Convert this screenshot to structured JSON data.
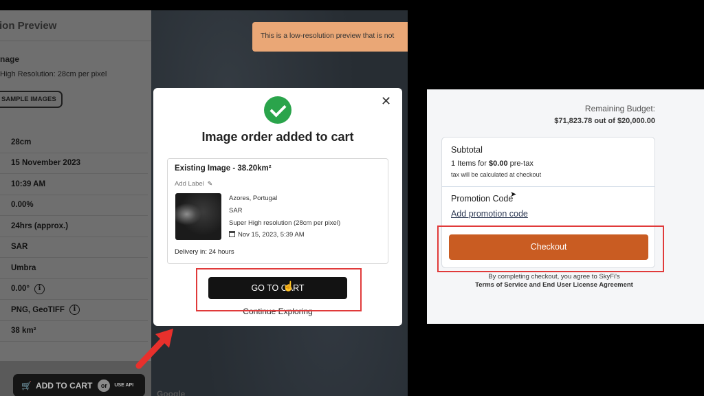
{
  "left_app": {
    "sidebar": {
      "header_title": "tion Preview",
      "section_title": "nage",
      "resolution_text": "High Resolution: 28cm per pixel",
      "sample_button": "SAMPLE IMAGES",
      "rows": [
        {
          "value": "28cm"
        },
        {
          "value": "15 November 2023"
        },
        {
          "value": "10:39 AM"
        },
        {
          "value": "0.00%"
        },
        {
          "value": "24hrs (approx.)"
        },
        {
          "value": "SAR"
        },
        {
          "value": "Umbra"
        },
        {
          "value": "0.00°",
          "info": true
        },
        {
          "value": "PNG, GeoTIFF",
          "info": true
        },
        {
          "value": "38 km²"
        }
      ],
      "add_to_cart_label": "ADD TO CART",
      "or_label": "or",
      "use_api_label": "USE API"
    },
    "banner_text": "This is a low-resolution preview that is not",
    "google_mark": "Google"
  },
  "modal": {
    "title": "Image order added to cart",
    "close_icon": "close-icon",
    "card": {
      "title": "Existing Image - 38.20km²",
      "add_label": "Add Label",
      "location": "Azores, Portugal",
      "sensor": "SAR",
      "resolution": "Super High resolution (28cm per pixel)",
      "date": "Nov 15, 2023, 5:39 AM",
      "delivery": "Delivery in: 24 hours"
    },
    "go_to_cart_label": "GO TO CART",
    "continue_label": "Continue Exploring"
  },
  "checkout": {
    "remaining_budget_label": "Remaining Budget:",
    "remaining_budget_value": "$71,823.78 out of $20,000.00",
    "subtotal_title": "Subtotal",
    "items_prefix": "1 Items for ",
    "items_amount": "$0.00",
    "items_suffix": " pre-tax",
    "tax_note": "tax will be calculated at checkout",
    "promotion_title": "Promotion Code",
    "promotion_link": "Add promotion code",
    "checkout_label": "Checkout",
    "disclaimer_line1": "By completing checkout, you agree to SkyFi's",
    "disclaimer_line2": "Terms of Service and End User License Agreement"
  },
  "colors": {
    "highlight_red": "#e03a3a",
    "checkout_orange": "#c95c22",
    "success_green": "#2aa44b",
    "banner_orange": "#eaa776"
  }
}
